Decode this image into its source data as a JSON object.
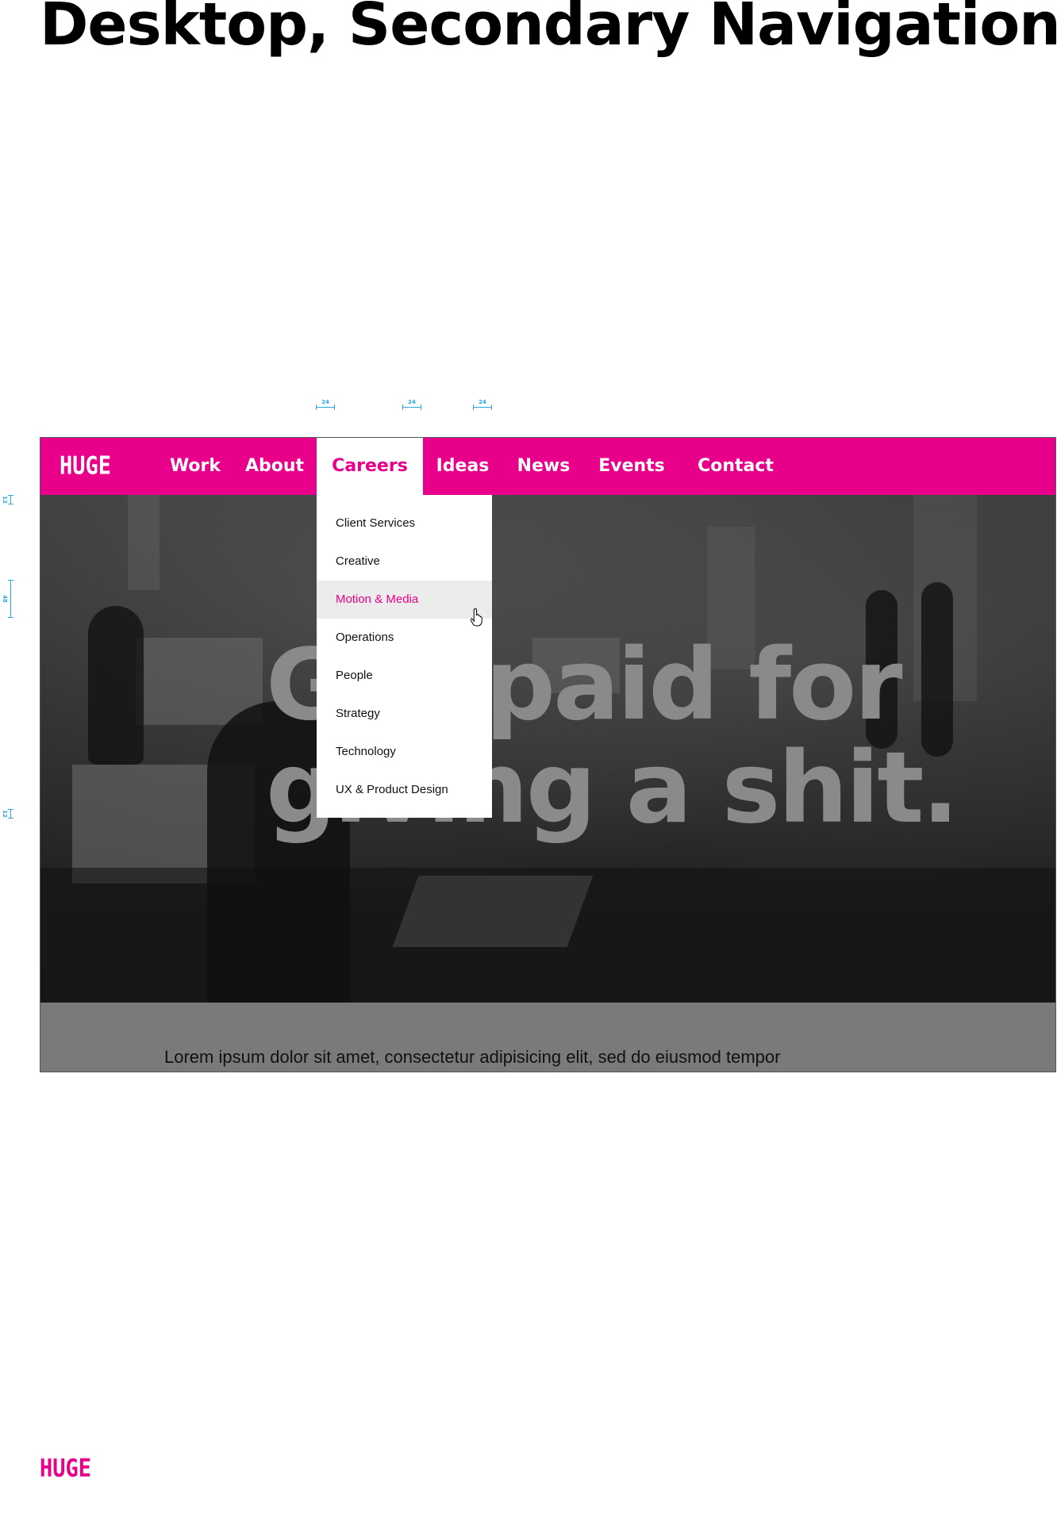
{
  "page": {
    "heading": "Desktop, Secondary Navigation."
  },
  "spec": {
    "spacing_24": "24",
    "spacing_12": "12",
    "spacing_48": "48"
  },
  "nav": {
    "logo": "HUGE",
    "items": [
      "Work",
      "About",
      "Careers",
      "Ideas",
      "News",
      "Events",
      "Contact"
    ],
    "active": "Careers"
  },
  "dropdown": {
    "items": [
      "Client Services",
      "Creative",
      "Motion & Media",
      "Operations",
      "People",
      "Strategy",
      "Technology",
      "UX & Product Design"
    ],
    "hovered": "Motion & Media"
  },
  "hero": {
    "headline_line1": "Get paid for",
    "headline_line2": "giving a shit."
  },
  "content": {
    "body": "Lorem ipsum dolor sit amet, consectetur adipisicing elit, sed do eiusmod tempor"
  },
  "footer": {
    "logo": "HUGE"
  },
  "colors": {
    "brand": "#e8008b",
    "spec": "#29a9e0",
    "hover_bg": "#ececec"
  }
}
